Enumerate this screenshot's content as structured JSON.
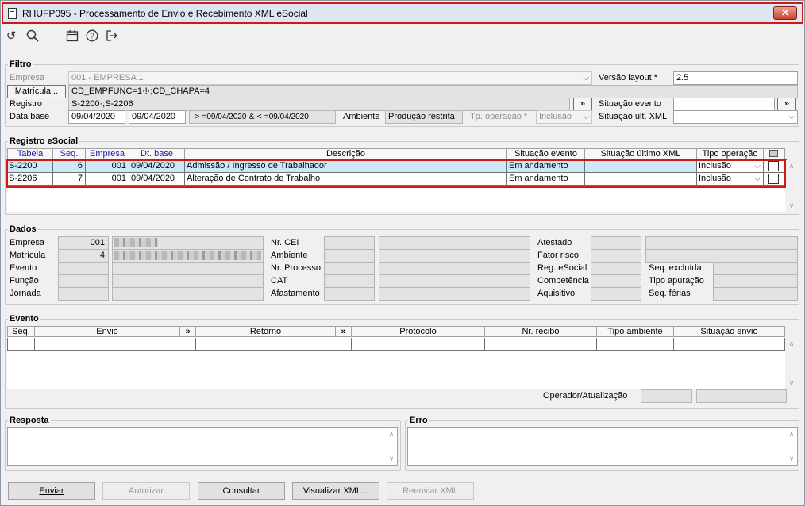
{
  "window": {
    "title": "RHUFP095 - Processamento de Envio e Recebimento XML eSocial",
    "close": "✕"
  },
  "toolbar": {
    "refresh_icon": "refresh-icon",
    "search_icon": "search-icon",
    "calendar_icon": "calendar-icon",
    "help_icon": "help-icon",
    "exit_icon": "exit-icon"
  },
  "filtro": {
    "title": "Filtro",
    "empresa_label": "Empresa",
    "empresa_value": "001 - EMPRESA 1",
    "versao_label": "Versão layout *",
    "versao_value": "2.5",
    "matricula_button": "Matrícula...",
    "matricula_value": "CD_EMPFUNC=1·!·;CD_CHAPA=4",
    "registro_label": "Registro",
    "registro_value": "S-2200·;S-2206",
    "registro_btn": "»",
    "situacao_evento_label": "Situação evento",
    "situacao_evento_value": "",
    "situacao_evento_btn": "»",
    "data_base_label": "Data base",
    "data_inicio": "09/04/2020",
    "data_fim": "09/04/2020",
    "data_expr": "·>·=09/04/2020·&·<·=09/04/2020",
    "ambiente_label": "Ambiente",
    "ambiente_value": "Produção restrita",
    "tp_operacao_label": "Tp. operação *",
    "tp_operacao_value": "Inclusão",
    "situacao_xml_label": "Situação últ. XML",
    "situacao_xml_value": ""
  },
  "registro": {
    "title": "Registro eSocial",
    "headers": [
      "Tabela",
      "Seq.",
      "Empresa",
      "Dt. base",
      "Descrição",
      "Situação evento",
      "Situação último XML",
      "Tipo operação",
      ""
    ],
    "rows": [
      {
        "tabela": "S-2200",
        "seq": "6",
        "empresa": "001",
        "dt_base": "09/04/2020",
        "descricao": "Admissão / Ingresso de Trabalhador",
        "situacao": "Em andamento",
        "situacao_xml": "",
        "tipo": "Inclusão"
      },
      {
        "tabela": "S-2206",
        "seq": "7",
        "empresa": "001",
        "dt_base": "09/04/2020",
        "descricao": "Alteração de Contrato de Trabalho",
        "situacao": "Em andamento",
        "situacao_xml": "",
        "tipo": "Inclusão"
      }
    ]
  },
  "dados": {
    "title": "Dados",
    "empresa_label": "Empresa",
    "empresa_value": "001",
    "matricula_label": "Matrícula",
    "matricula_value": "4",
    "evento_label": "Evento",
    "funcao_label": "Função",
    "jornada_label": "Jornada",
    "nrcei_label": "Nr. CEI",
    "ambiente_label": "Ambiente",
    "nrprocesso_label": "Nr. Processo",
    "cat_label": "CAT",
    "afastamento_label": "Afastamento",
    "atestado_label": "Atestado",
    "fatorrisco_label": "Fator risco",
    "regesocial_label": "Reg. eSocial",
    "competencia_label": "Competência",
    "aquisitivo_label": "Aquisitivo",
    "seqexcluida_label": "Seq. excluída",
    "tipoapuracao_label": "Tipo apuração",
    "seqferias_label": "Seq. férias"
  },
  "evento": {
    "title": "Evento",
    "headers": [
      "Seq.",
      "Envio",
      "»",
      "Retorno",
      "»",
      "Protocolo",
      "Nr. recibo",
      "Tipo ambiente",
      "Situação envio"
    ],
    "operador_label": "Operador/Atualização"
  },
  "resposta": {
    "title": "Resposta"
  },
  "erro": {
    "title": "Erro"
  },
  "buttons": {
    "enviar": "Enviar",
    "autorizar": "Autorizar",
    "consultar": "Consultar",
    "visualizar": "Visualizar XML...",
    "reenviar": "Reenviar XML"
  },
  "colors": {
    "highlight": "#d01818",
    "header_blue": "#1a1ab0"
  }
}
